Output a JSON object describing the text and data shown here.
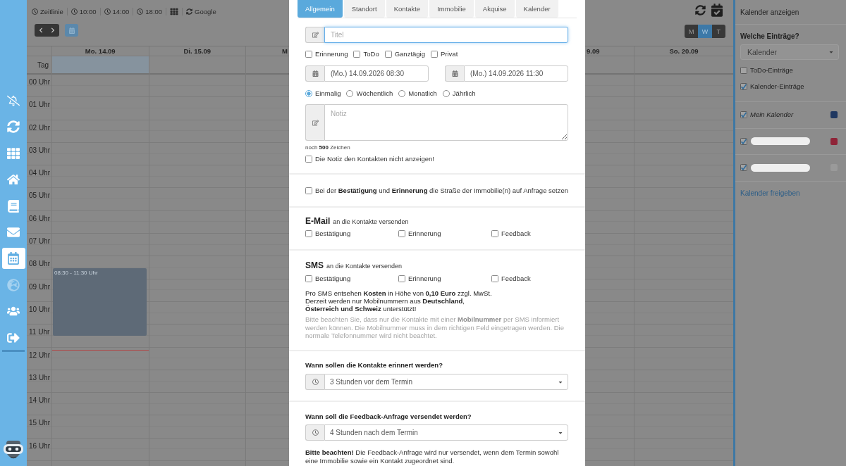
{
  "sidebar": {
    "items": [
      {
        "selected": false,
        "disabled": false
      },
      {
        "selected": false,
        "disabled": false
      },
      {
        "selected": false,
        "disabled": false
      },
      {
        "selected": false,
        "disabled": false
      },
      {
        "selected": false,
        "disabled": false
      },
      {
        "selected": false,
        "disabled": false
      },
      {
        "selected": true,
        "disabled": false
      },
      {
        "selected": false,
        "disabled": true
      },
      {
        "selected": false,
        "disabled": false
      },
      {
        "selected": false,
        "disabled": false
      }
    ]
  },
  "calendar": {
    "toolbar": [
      {
        "kind": "clock",
        "label": "Zeitlinie"
      },
      {
        "kind": "clock",
        "label": "10:00"
      },
      {
        "kind": "clock",
        "label": "14:00"
      },
      {
        "kind": "clock",
        "label": "18:00"
      },
      {
        "kind": "grid"
      },
      {
        "kind": "sync",
        "label": "Google"
      }
    ],
    "view_modes": [
      {
        "label": "M",
        "selected": false
      },
      {
        "label": "W",
        "selected": true
      },
      {
        "label": "T",
        "selected": false
      }
    ],
    "all_day_label": "Tag",
    "hours": [
      "00 Uhr",
      "01 Uhr",
      "02 Uhr",
      "03 Uhr",
      "04 Uhr",
      "05 Uhr",
      "06 Uhr",
      "07 Uhr",
      "08 Uhr",
      "09 Uhr",
      "10 Uhr",
      "11 Uhr",
      "12 Uhr",
      "13 Uhr",
      "14 Uhr",
      "15 Uhr",
      "16 Uhr"
    ],
    "days_before_dialog": [
      {
        "label": "Mo. 14.09",
        "today": true,
        "events": [
          {
            "time": "08:30 - 11:30 Uhr"
          }
        ]
      },
      {
        "label": "Di. 15.09",
        "today": false
      },
      {
        "label": "M",
        "today": false
      }
    ],
    "days_after_dialog": [
      {
        "label": "9.09",
        "today": false
      },
      {
        "label": "So. 20.09",
        "today": false
      }
    ]
  },
  "dialog": {
    "tabs": [
      {
        "label": "Allgemein",
        "selected": true
      },
      {
        "label": "Standort",
        "selected": false
      },
      {
        "label": "Kontakte",
        "selected": false
      },
      {
        "label": "Immobilie",
        "selected": false
      },
      {
        "label": "Akquise",
        "selected": false
      },
      {
        "label": "Kalender",
        "selected": false
      }
    ],
    "title_field": {
      "placeholder": "Titel",
      "focused": true
    },
    "flags": [
      {
        "label": "Erinnerung",
        "checked": false
      },
      {
        "label": "ToDo",
        "checked": false
      },
      {
        "label": "Ganztägig",
        "checked": false
      },
      {
        "label": "Privat",
        "checked": false
      }
    ],
    "start": "(Mo.) 14.09.2026 08:30",
    "end": "(Mo.) 14.09.2026 11:30",
    "recurrence": [
      {
        "label": "Einmalig",
        "selected": true
      },
      {
        "label": "Wöchentlich",
        "selected": false
      },
      {
        "label": "Monatlich",
        "selected": false
      },
      {
        "label": "Jährlich",
        "selected": false
      }
    ],
    "note_field": {
      "placeholder": "Notiz"
    },
    "note_counter": "noch **500** Zeichen",
    "hide_note": {
      "label": "Die Notiz den Kontakten nicht anzeigen!",
      "checked": false
    },
    "street_option": {
      "label": "Bei der **Bestätigung** und **Erinnerung** die Straße der Immobilie(n) auf Anfrage setzen",
      "checked": false
    },
    "email": {
      "title": "E-Mail",
      "subtitle": "an die Kontakte versenden",
      "options": [
        {
          "label": "Bestätigung",
          "checked": false
        },
        {
          "label": "Erinnerung",
          "checked": false
        },
        {
          "label": "Feedback",
          "checked": false
        }
      ]
    },
    "sms": {
      "title": "SMS",
      "subtitle": "an die Kontakte versenden",
      "options": [
        {
          "label": "Bestätigung",
          "checked": false
        },
        {
          "label": "Erinnerung",
          "checked": false
        },
        {
          "label": "Feedback",
          "checked": false
        }
      ],
      "cost_note": [
        "Pro SMS entsehen **Kosten** in Höhe von **0,10 Euro** zzgl. MwSt.",
        "Derzeit werden nur Mobilnummern aus **Deutschland**,",
        "**Österreich und Schweiz** unterstützt!"
      ],
      "hint": "Bitte beachten Sie, dass nur die Kontakte mit einer **Mobilnummer** per SMS informiert werden können. Die Mobilnummer muss in dem richtigen Feld eingetragen werden. Die normale Telefonnummer wird nicht beachtet."
    },
    "reminder": {
      "question": "Wann sollen die Kontakte erinnert werden?",
      "value": "3 Stunden vor dem Termin"
    },
    "feedback": {
      "question": "Wann soll die Feedback-Anfrage versendet werden?",
      "value": "4 Stunden nach dem Termin",
      "note": "**Bitte beachten!** Die Feedback-Anfrage wird nur versendet, wenn dem Termin sowohl eine Immobilie sowie ein Kontakt zugeordnet sind."
    }
  },
  "calendar_panel": {
    "title": "Kalender anzeigen",
    "entries_label": "Welche Einträge?",
    "entries_select": "Kalender",
    "entry_types": [
      {
        "label": "ToDo-Einträge",
        "checked": false
      },
      {
        "label": "Kalender-Einträge",
        "checked": true
      }
    ],
    "calendars": [
      {
        "kind": "named",
        "name": "Mein Kalender",
        "checked": true,
        "color": "#1f3760"
      },
      {
        "kind": "redacted",
        "checked": true,
        "color": "#8f2438"
      },
      {
        "kind": "redacted",
        "checked": true,
        "color": "#9a9a9a"
      }
    ],
    "share_link": "Kalender freigeben"
  }
}
